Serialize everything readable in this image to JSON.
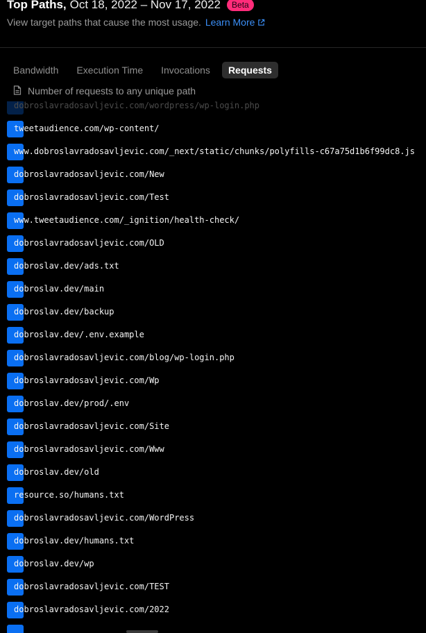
{
  "header": {
    "title": "Top Paths,",
    "date_range": "Oct 18, 2022 – Nov 17, 2022",
    "badge": "Beta",
    "subtitle": "View target paths that cause the most usage.",
    "learn_more": "Learn More",
    "learn_more_icon": "external-link-icon"
  },
  "tabs": [
    {
      "label": "Bandwidth",
      "active": false
    },
    {
      "label": "Execution Time",
      "active": false
    },
    {
      "label": "Invocations",
      "active": false
    },
    {
      "label": "Requests",
      "active": true
    }
  ],
  "description": {
    "icon": "document-icon",
    "text": "Number of requests to any unique path"
  },
  "colors": {
    "bar": "#0a6ff2",
    "badge": "#ff2c7a",
    "link": "#3b8ef5",
    "active_tab_bg": "#2e2e2e"
  },
  "paths": [
    "dobroslavradosavljevic.com/wordpress/wp-login.php",
    "tweetaudience.com/wp-content/",
    "www.dobroslavradosavljevic.com/_next/static/chunks/polyfills-c67a75d1b6f99dc8.js",
    "dobroslavradosavljevic.com/New",
    "dobroslavradosavljevic.com/Test",
    "www.tweetaudience.com/_ignition/health-check/",
    "dobroslavradosavljevic.com/OLD",
    "dobroslav.dev/ads.txt",
    "dobroslav.dev/main",
    "dobroslav.dev/backup",
    "dobroslav.dev/.env.example",
    "dobroslavradosavljevic.com/blog/wp-login.php",
    "dobroslavradosavljevic.com/Wp",
    "dobroslav.dev/prod/.env",
    "dobroslavradosavljevic.com/Site",
    "dobroslavradosavljevic.com/Www",
    "dobroslav.dev/old",
    "resource.so/humans.txt",
    "dobroslavradosavljevic.com/WordPress",
    "dobroslav.dev/humans.txt",
    "dobroslav.dev/wp",
    "dobroslavradosavljevic.com/TEST",
    "dobroslavradosavljevic.com/2022",
    ""
  ]
}
